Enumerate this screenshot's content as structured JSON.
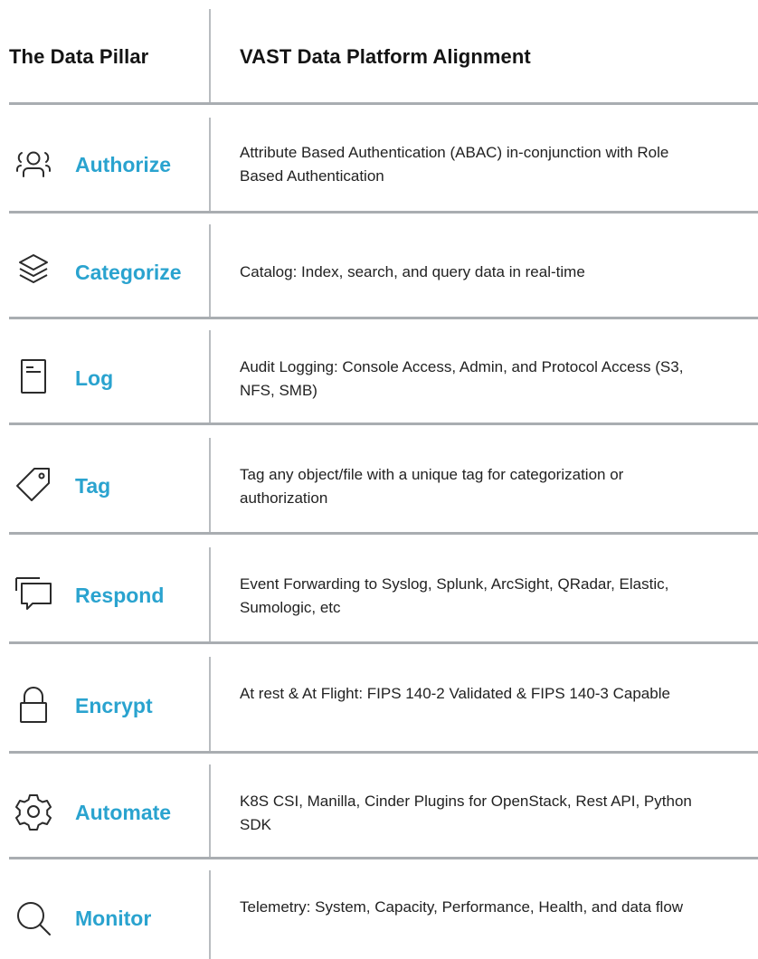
{
  "header": {
    "left_title": "The Data Pillar",
    "right_title": "VAST Data Platform Alignment"
  },
  "rows": [
    {
      "icon": "people-icon",
      "name": "Authorize",
      "desc": "Attribute Based Authentication (ABAC)  in-conjunction with Role Based Authentication"
    },
    {
      "icon": "layers-icon",
      "name": "Categorize",
      "desc": "Catalog: Index, search, and query data in real-time"
    },
    {
      "icon": "document-icon",
      "name": "Log",
      "desc": "Audit Logging: Console Access, Admin, and Protocol Access (S3, NFS, SMB)"
    },
    {
      "icon": "tag-icon",
      "name": "Tag",
      "desc": "Tag any object/file with a unique tag for categorization or authorization"
    },
    {
      "icon": "chat-icon",
      "name": "Respond",
      "desc": "Event Forwarding to Syslog, Splunk, ArcSight, QRadar, Elastic, Sumologic, etc"
    },
    {
      "icon": "lock-icon",
      "name": "Encrypt",
      "desc": "At rest & At Flight: FIPS 140-2 Validated & FIPS 140-3 Capable"
    },
    {
      "icon": "gear-icon",
      "name": "Automate",
      "desc": "K8S CSI, Manilla, Cinder Plugins for OpenStack, Rest API, Python SDK"
    },
    {
      "icon": "search-icon",
      "name": "Monitor",
      "desc": "Telemetry: System, Capacity, Performance, Health, and data flow"
    }
  ],
  "colors": {
    "accent": "#2aa3cf",
    "divider": "#a9adb1",
    "text": "#222222"
  }
}
